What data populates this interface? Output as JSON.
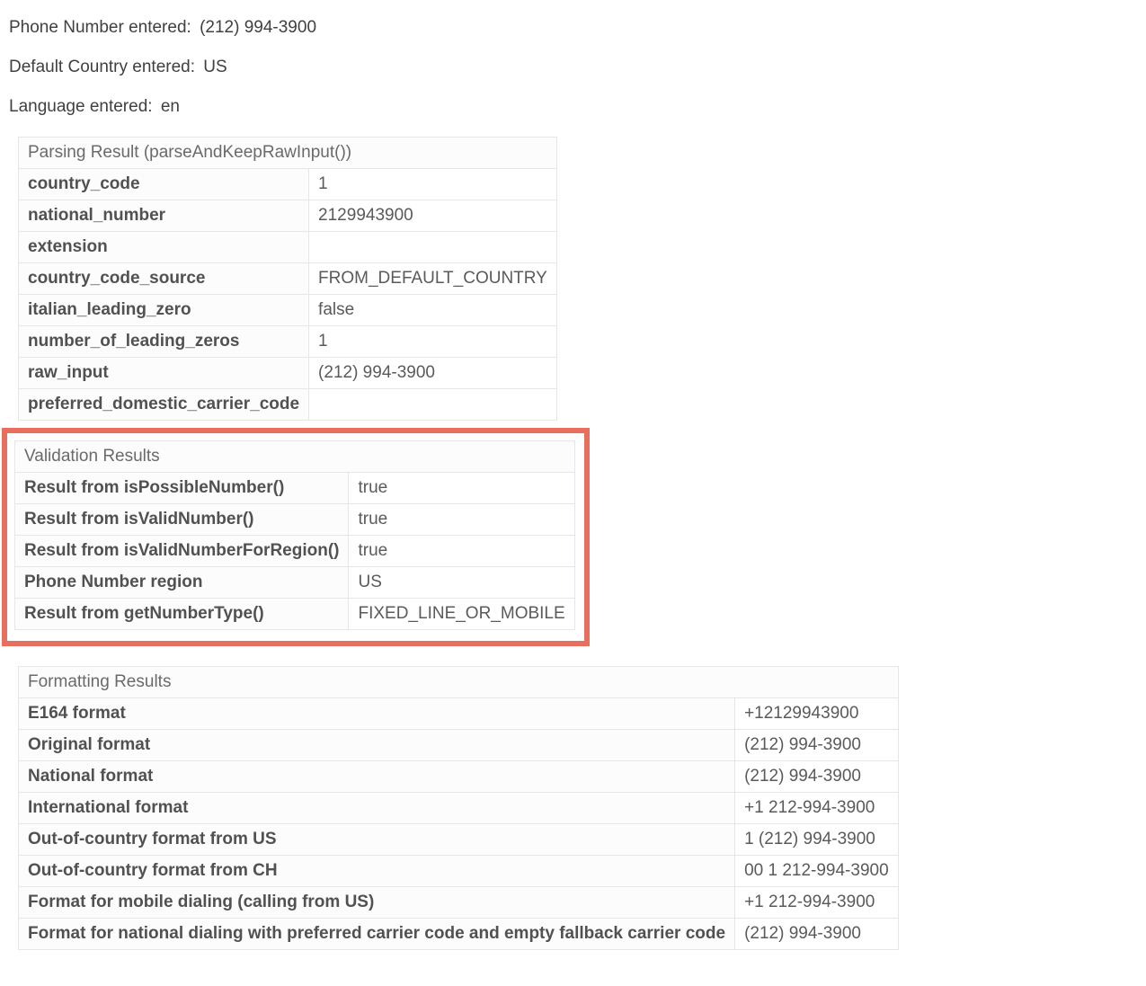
{
  "summary": {
    "phone_label": "Phone Number entered:",
    "phone_value": "(212) 994-3900",
    "country_label": "Default Country entered:",
    "country_value": "US",
    "language_label": "Language entered:",
    "language_value": "en"
  },
  "parsing": {
    "title": "Parsing Result (parseAndKeepRawInput())",
    "rows": [
      {
        "k": "country_code",
        "v": "1"
      },
      {
        "k": "national_number",
        "v": "2129943900"
      },
      {
        "k": "extension",
        "v": ""
      },
      {
        "k": "country_code_source",
        "v": "FROM_DEFAULT_COUNTRY"
      },
      {
        "k": "italian_leading_zero",
        "v": "false"
      },
      {
        "k": "number_of_leading_zeros",
        "v": "1"
      },
      {
        "k": "raw_input",
        "v": "(212) 994-3900"
      },
      {
        "k": "preferred_domestic_carrier_code",
        "v": ""
      }
    ]
  },
  "validation": {
    "title": "Validation Results",
    "rows": [
      {
        "k": "Result from isPossibleNumber()",
        "v": "true"
      },
      {
        "k": "Result from isValidNumber()",
        "v": "true"
      },
      {
        "k": "Result from isValidNumberForRegion()",
        "v": "true"
      },
      {
        "k": "Phone Number region",
        "v": "US"
      },
      {
        "k": "Result from getNumberType()",
        "v": "FIXED_LINE_OR_MOBILE"
      }
    ]
  },
  "formatting": {
    "title": "Formatting Results",
    "rows": [
      {
        "k": "E164 format",
        "v": "+12129943900"
      },
      {
        "k": "Original format",
        "v": "(212) 994-3900"
      },
      {
        "k": "National format",
        "v": "(212) 994-3900"
      },
      {
        "k": "International format",
        "v": "+1 212-994-3900"
      },
      {
        "k": "Out-of-country format from US",
        "v": "1 (212) 994-3900"
      },
      {
        "k": "Out-of-country format from CH",
        "v": "00 1 212-994-3900"
      },
      {
        "k": "Format for mobile dialing (calling from US)",
        "v": "+1 212-994-3900"
      },
      {
        "k": "Format for national dialing with preferred carrier code and empty fallback carrier code",
        "v": "(212) 994-3900"
      }
    ]
  }
}
